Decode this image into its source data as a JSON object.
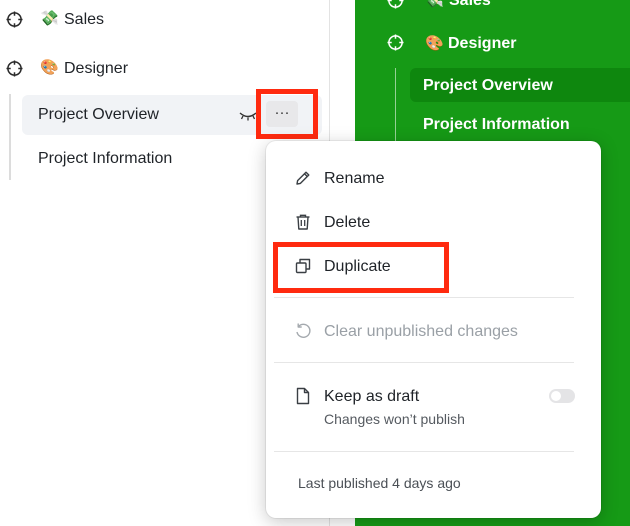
{
  "sidebar": {
    "sections": [
      {
        "emoji": "💸",
        "label": "Sales"
      },
      {
        "emoji": "🎨",
        "label": "Designer"
      }
    ],
    "pages": [
      {
        "label": "Project Overview",
        "active": true
      },
      {
        "label": "Project Information",
        "active": false
      }
    ],
    "more_button_label": "···"
  },
  "preview": {
    "sections": [
      {
        "emoji": "💸",
        "label": "Sales"
      },
      {
        "emoji": "🎨",
        "label": "Designer"
      }
    ],
    "pages": [
      {
        "label": "Project Overview",
        "active": true
      },
      {
        "label": "Project Information",
        "active": false
      }
    ],
    "background_color": "#169a16"
  },
  "menu": {
    "items": [
      {
        "icon": "pencil-icon",
        "label": "Rename"
      },
      {
        "icon": "trash-icon",
        "label": "Delete"
      },
      {
        "icon": "copy-icon",
        "label": "Duplicate"
      },
      {
        "icon": "undo-icon",
        "label": "Clear unpublished changes",
        "disabled": true
      }
    ],
    "draft": {
      "icon": "document-icon",
      "label": "Keep as draft",
      "sublabel": "Changes won’t publish",
      "toggle_on": false
    },
    "footer": "Last published 4 days ago"
  },
  "highlight_color": "#ff2a0f"
}
